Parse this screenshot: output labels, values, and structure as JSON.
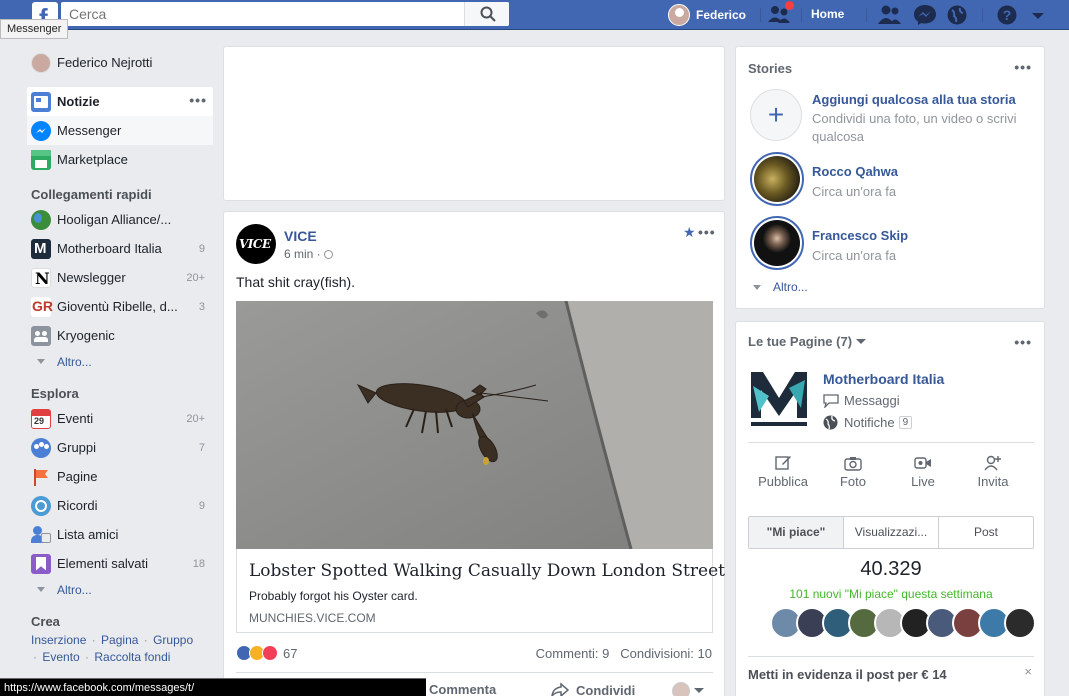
{
  "topbar": {
    "search_placeholder": "Cerca",
    "user_name": "Federico",
    "home_label": "Home"
  },
  "tooltip": "Messenger",
  "status_url": "https://www.facebook.com/messages/t/",
  "leftnav": {
    "profile_name": "Federico Nejrotti",
    "main_items": [
      {
        "label": "Notizie",
        "icon": "news-feed-icon"
      },
      {
        "label": "Messenger",
        "icon": "messenger-icon"
      },
      {
        "label": "Marketplace",
        "icon": "marketplace-icon"
      }
    ],
    "shortcuts_title": "Collegamenti rapidi",
    "shortcuts": [
      {
        "label": "Hooligan Alliance/...",
        "count": ""
      },
      {
        "label": "Motherboard Italia",
        "count": "9"
      },
      {
        "label": "Newslegger",
        "count": "20+"
      },
      {
        "label": "Gioventù Ribelle, d...",
        "count": "3"
      },
      {
        "label": "Kryogenic",
        "count": ""
      }
    ],
    "altro_label": "Altro...",
    "explore_title": "Esplora",
    "explore": [
      {
        "label": "Eventi",
        "count": "20+",
        "icon": "calendar-icon"
      },
      {
        "label": "Gruppi",
        "count": "7",
        "icon": "groups-icon"
      },
      {
        "label": "Pagine",
        "count": "",
        "icon": "flag-icon"
      },
      {
        "label": "Ricordi",
        "count": "9",
        "icon": "memories-icon"
      },
      {
        "label": "Lista amici",
        "count": "",
        "icon": "friend-list-icon"
      },
      {
        "label": "Elementi salvati",
        "count": "18",
        "icon": "saved-icon"
      }
    ],
    "create_title": "Crea",
    "create_links": [
      "Inserzione",
      "Pagina",
      "Gruppo",
      "Evento",
      "Raccolta fondi"
    ]
  },
  "post": {
    "author": "VICE",
    "avatar_text": "VICE",
    "time": "6 min",
    "text": "That shit cray(fish).",
    "link_title": "Lobster Spotted Walking Casually Down London Street",
    "link_desc": "Probably forgot his Oyster card.",
    "link_domain": "MUNCHIES.VICE.COM",
    "reaction_count": "67",
    "comments": "Commenti: 9",
    "shares": "Condivisioni: 10",
    "actions": {
      "comment": "Commenta",
      "share": "Condividi"
    }
  },
  "stories": {
    "title": "Stories",
    "items": [
      {
        "name": "Aggiungi qualcosa alla tua storia",
        "sub": "Condividi una foto, un video o scrivi qualcosa"
      },
      {
        "name": "Rocco Qahwa",
        "sub": "Circa un'ora fa"
      },
      {
        "name": "Francesco Skip",
        "sub": "Circa un'ora fa"
      }
    ],
    "altro_label": "Altro..."
  },
  "pages": {
    "title": "Le tue Pagine (7)",
    "page_name": "Motherboard Italia",
    "messages_label": "Messaggi",
    "notifications_label": "Notifiche",
    "notifications_count": "9",
    "actions": [
      "Pubblica",
      "Foto",
      "Live",
      "Invita"
    ],
    "tabs": [
      "\"Mi piace\"",
      "Visualizzazi...",
      "Post"
    ],
    "likes_total": "40.329",
    "likes_new": "101 nuovi \"Mi piace\" questa settimana",
    "promo": "Metti in evidenza il post per € 14",
    "promo_close": "×"
  },
  "colors": {
    "brand_blue": "#4267b2",
    "link_blue": "#365899",
    "green": "#42b72a"
  }
}
